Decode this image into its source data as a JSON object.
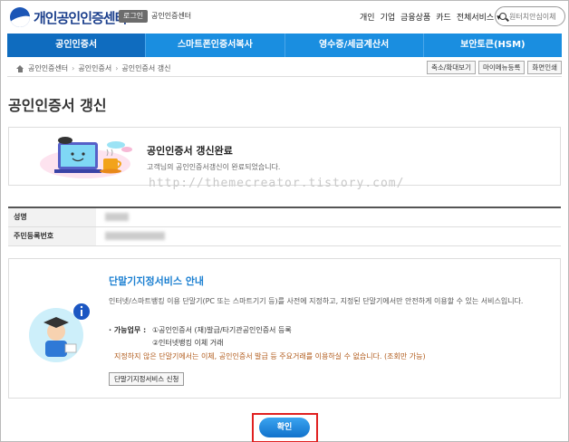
{
  "header": {
    "logo_text": "개인공인인증센터",
    "login_label": "로그인",
    "site_name": "공인인증센터",
    "top_menu": [
      "개인",
      "기업",
      "금융상품",
      "카드",
      "전체서비스 ▾"
    ],
    "search_placeholder": "원터치안심이체"
  },
  "nav": {
    "tabs": [
      "공인인증서",
      "스마트폰인증서복사",
      "영수증/세금계산서",
      "보안토큰(HSM)"
    ]
  },
  "breadcrumb": {
    "items": [
      "공인인증센터",
      "공인인증서",
      "공인인증서 갱신"
    ]
  },
  "utility_buttons": [
    "축소/확대보기",
    "마이메뉴등록",
    "화면인쇄"
  ],
  "page_title": "공인인증서 갱신",
  "complete": {
    "title": "공인인증서 갱신완료",
    "message": "고객님의 공인인증서갱신이 완료되었습니다."
  },
  "watermark": "http://themecreator.tistory.com/",
  "info_table": {
    "rows": [
      {
        "label": "성명"
      },
      {
        "label": "주민등록번호"
      }
    ]
  },
  "service": {
    "title": "단말기지정서비스 안내",
    "description": "인터넷/스마트뱅킹 이용 단말기(PC 또는 스마트기기 등)를 사전에 지정하고, 지정된 단말기에서만 안전하게 이용할 수 있는 서비스입니다.",
    "tasks_label": "· 가능업무 :",
    "tasks": [
      "①공인인증서 (재)발급/타기관공인인증서 등록",
      "②인터넷뱅킹 이체 거래"
    ],
    "warning": "지정하지 않은 단말기에서는 이체, 공인인증서 발급 등 주요거래를 이용하실 수 없습니다. (조회만 가능)",
    "apply_label": "단말기지정서비스 신청"
  },
  "confirm_label": "확인",
  "colors": {
    "nav_bg": "#1a8ee0",
    "nav_active": "#0f6cbf",
    "service_title": "#1a7fd1",
    "warning_text": "#b05a1a",
    "highlight_outline": "#e02020"
  }
}
